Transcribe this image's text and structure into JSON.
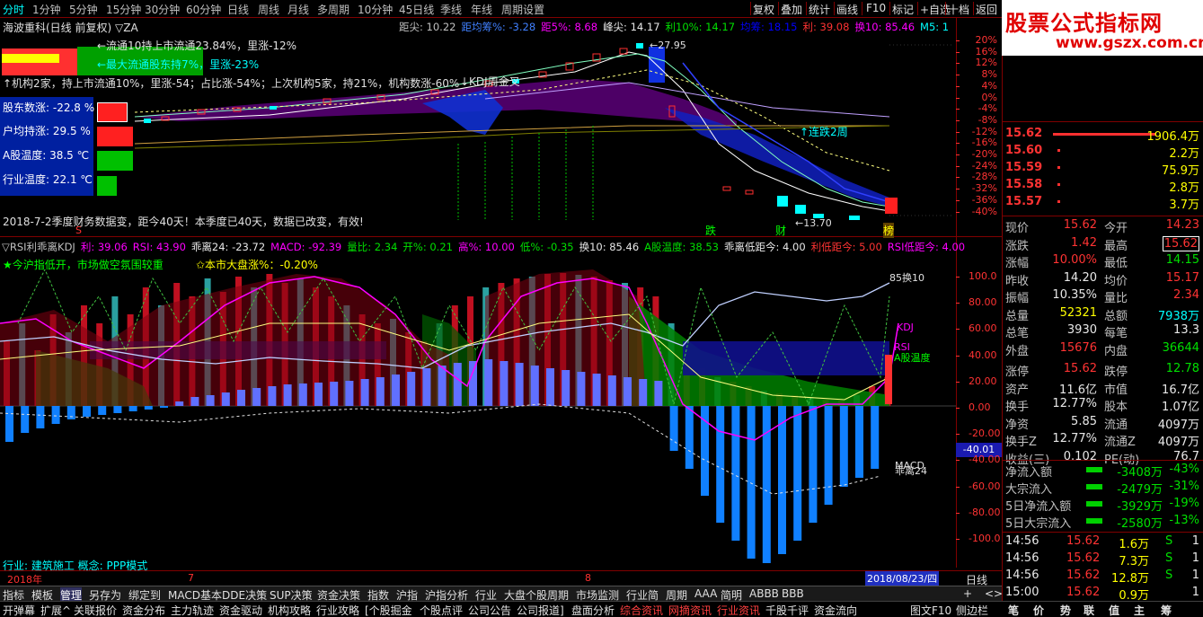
{
  "topbar": {
    "periods": [
      "分时",
      "1分钟",
      "5分钟",
      "15分钟",
      "30分钟",
      "60分钟",
      "日线",
      "周线",
      "月线",
      "多周期",
      "10分钟",
      "45日线",
      "季线",
      "年线",
      "周期设置"
    ],
    "right": [
      "复权",
      "叠加",
      "统计",
      "画线",
      "F10",
      "标记",
      "+自选",
      "十档",
      "返回"
    ]
  },
  "logo": {
    "title": "股票公式指标网",
    "url": "www.gszx.com.cn"
  },
  "main": {
    "title": "海波重科(日线 前复权) ▽ZA",
    "legend": [
      {
        "t": "距尖:",
        "v": "10.22",
        "c": "#c0c0c0"
      },
      {
        "t": "距均筹%:",
        "v": "-3.28",
        "c": "#4080ff"
      },
      {
        "t": "距5%:",
        "v": "8.68",
        "c": "#ff00ff"
      },
      {
        "t": "峰尖:",
        "v": "14.17",
        "c": "#e8e8e8"
      },
      {
        "t": "利10%:",
        "v": "14.17",
        "c": "#00e000"
      },
      {
        "t": "均筹:",
        "v": "18.15",
        "c": "#0000ff"
      },
      {
        "t": "利:",
        "v": "39.08",
        "c": "#ff3333"
      },
      {
        "t": "换10:",
        "v": "85.46",
        "c": "#ff00ff"
      },
      {
        "t": "M5:",
        "v": "1",
        "c": "#00ffff"
      }
    ],
    "left_stats": [
      {
        "label": "股东数涨:",
        "value": "-22.8 %"
      },
      {
        "label": "户均持涨:",
        "value": "29.5 %"
      },
      {
        "label": "A股温度:",
        "value": "38.5 ℃"
      },
      {
        "label": "行业温度:",
        "value": "22.1 ℃"
      }
    ],
    "notes": {
      "n1": "←流通10持上市流通23.84%，里涨-12%",
      "n2": "←最大流通股东持7%，里涨-23%",
      "n3": "↑机构2家，持上市流通10%，里涨-54；占比涨-54%；上次机构5家，持21%，机构数涨-60%",
      "n4": "2018-7-2季度财务数据变，距今40天！本季度已40天，数据已改变，有效!",
      "kdj": "↓KDJ周金叉",
      "peak": "←27.95",
      "low": "←13.70",
      "drop": "↑连跌2周",
      "m_die": "跌",
      "m_cai": "财",
      "m_bang": "榜",
      "m_s": "S"
    },
    "yticks": [
      "20%",
      "16%",
      "12%",
      "8%",
      "4%",
      "0%",
      "-4%",
      "-8%",
      "-12%",
      "-16%",
      "-20%",
      "-24%",
      "-28%",
      "-32%",
      "-36%",
      "-40%"
    ]
  },
  "indicator": {
    "legend": [
      {
        "t": "▽RSI利乖离KDJ",
        "v": "",
        "c": "#c0c0c0"
      },
      {
        "t": "利:",
        "v": "39.06",
        "c": "#ff00ff"
      },
      {
        "t": "RSI:",
        "v": "43.90",
        "c": "#ff00ff"
      },
      {
        "t": "乖离24:",
        "v": "-23.72",
        "c": "#e8e8e8"
      },
      {
        "t": "MACD:",
        "v": "-92.39",
        "c": "#ff00ff"
      },
      {
        "t": "量比:",
        "v": "2.34",
        "c": "#00e000"
      },
      {
        "t": "开%:",
        "v": "0.21",
        "c": "#00e000"
      },
      {
        "t": "高%:",
        "v": "10.00",
        "c": "#ff00ff"
      },
      {
        "t": "低%:",
        "v": "-0.35",
        "c": "#00e000"
      },
      {
        "t": "换10:",
        "v": "85.46",
        "c": "#e8e8e8"
      },
      {
        "t": "A股温度:",
        "v": "38.53",
        "c": "#00e000"
      },
      {
        "t": "乖离低距今:",
        "v": "4.00",
        "c": "#e8e8e8"
      },
      {
        "t": "利低距今:",
        "v": "5.00",
        "c": "#ff3333"
      },
      {
        "t": "RSI低距今:",
        "v": "4.00",
        "c": "#ff00ff"
      }
    ],
    "line2a": "★今沪指低开，市场做空氛围较重",
    "line2b": "✩本市大盘涨%：-0.20%",
    "labels": {
      "huan10": "85换10",
      "kdj": "KDJ",
      "rsi": "RSI",
      "awd": "A股温度",
      "macd": "MACD",
      "gl24": "乖离24"
    },
    "yticks": [
      "100.0",
      "80.00",
      "60.00",
      "40.00",
      "20.00",
      "0.00",
      "-20.00",
      "-40.00",
      "-60.00",
      "-80.00",
      "-100.0"
    ],
    "cur_value": "-40.01",
    "industry": "行业: 建筑施工   概念: PPP模式"
  },
  "dates": {
    "year": "2018年",
    "m7": "7",
    "m8": "8",
    "sel": "2018/08/23/四",
    "period": "日线"
  },
  "quotes": {
    "asks": [
      {
        "p": "15.62",
        "v": "1906.4万"
      },
      {
        "p": "15.60",
        "v": "2.2万"
      },
      {
        "p": "15.59",
        "v": "75.9万"
      },
      {
        "p": "15.58",
        "v": "2.8万"
      },
      {
        "p": "15.57",
        "v": "3.7万"
      }
    ],
    "rows": [
      {
        "l1": "现价",
        "v1": "15.62",
        "c1": "red",
        "l2": "今开",
        "v2": "14.23",
        "c2": "red"
      },
      {
        "l1": "涨跌",
        "v1": "1.42",
        "c1": "red",
        "l2": "最高",
        "v2": "15.62",
        "c2": "red"
      },
      {
        "l1": "涨幅",
        "v1": "10.00%",
        "c1": "red",
        "l2": "最低",
        "v2": "14.15",
        "c2": "green"
      },
      {
        "l1": "昨收",
        "v1": "14.20",
        "c1": "white",
        "l2": "均价",
        "v2": "15.17",
        "c2": "red"
      },
      {
        "l1": "振幅",
        "v1": "10.35%",
        "c1": "white",
        "l2": "量比",
        "v2": "2.34",
        "c2": "red"
      },
      {
        "l1": "总量",
        "v1": "52321",
        "c1": "yellow",
        "l2": "总额",
        "v2": "7938万",
        "c2": "cyan"
      },
      {
        "l1": "总笔",
        "v1": "3930",
        "c1": "white",
        "l2": "每笔",
        "v2": "13.3",
        "c2": "white"
      },
      {
        "l1": "外盘",
        "v1": "15676",
        "c1": "red",
        "l2": "内盘",
        "v2": "36644",
        "c2": "green"
      },
      {
        "l1": "涨停",
        "v1": "15.62",
        "c1": "red",
        "l2": "跌停",
        "v2": "12.78",
        "c2": "green"
      },
      {
        "l1": "资产",
        "v1": "11.6亿",
        "c1": "white",
        "l2": "市值",
        "v2": "16.7亿",
        "c2": "white"
      },
      {
        "l1": "换手",
        "v1": "12.77%",
        "c1": "white",
        "l2": "股本",
        "v2": "1.07亿",
        "c2": "white"
      },
      {
        "l1": "净资",
        "v1": "5.85",
        "c1": "white",
        "l2": "流通",
        "v2": "4097万",
        "c2": "white"
      },
      {
        "l1": "换手Z",
        "v1": "12.77%",
        "c1": "white",
        "l2": "流通Z",
        "v2": "4097万",
        "c2": "white"
      },
      {
        "l1": "收益(三)",
        "v1": "0.102",
        "c1": "white",
        "l2": "PE(动)",
        "v2": "76.7",
        "c2": "white"
      }
    ],
    "flows": [
      {
        "l": "净流入额",
        "v": "-3408万",
        "p": "-43%"
      },
      {
        "l": "大宗流入",
        "v": "-2479万",
        "p": "-31%"
      },
      {
        "l": "5日净流入额",
        "v": "-3929万",
        "p": "-19%"
      },
      {
        "l": "5日大宗流入",
        "v": "-2580万",
        "p": "-13%"
      }
    ],
    "ticks": [
      {
        "t": "14:56",
        "p": "15.62",
        "v": "1.6万",
        "s": "S",
        "n": "1"
      },
      {
        "t": "14:56",
        "p": "15.62",
        "v": "7.3万",
        "s": "S",
        "n": "1"
      },
      {
        "t": "14:56",
        "p": "15.62",
        "v": "12.8万",
        "s": "S",
        "n": "1"
      },
      {
        "t": "15:00",
        "p": "15.62",
        "v": "0.9万",
        "s": "",
        "n": "1"
      }
    ]
  },
  "tabs1": [
    "指标",
    "模板",
    "管理",
    "另存为",
    "绑定到",
    "MACD基本",
    "DDE决策",
    "SUP决策",
    "资金决策",
    "指数",
    "沪指",
    "沪指分析",
    "行业",
    "大盘个股周期",
    "市场监测",
    "行业简",
    "周期",
    "AAA",
    "简明",
    "ABBB",
    "BBB"
  ],
  "tabs1_right": [
    "+",
    "<",
    ">"
  ],
  "tabs2": [
    "开弹幕",
    "扩展^",
    "关联报价",
    "资金分布",
    "主力轨迹",
    "资金驱动",
    "机构攻略",
    "行业攻略",
    "[个股掘金",
    "个股点评",
    "公司公告",
    "公司报道]",
    "盘面分析",
    "综合资讯",
    "网摘资讯",
    "行业资讯",
    "千股千评",
    "资金流向"
  ],
  "tabs2_right": [
    "图文F10",
    "侧边栏",
    "笔",
    "价",
    "势",
    "联",
    "值",
    "主",
    "筹"
  ]
}
